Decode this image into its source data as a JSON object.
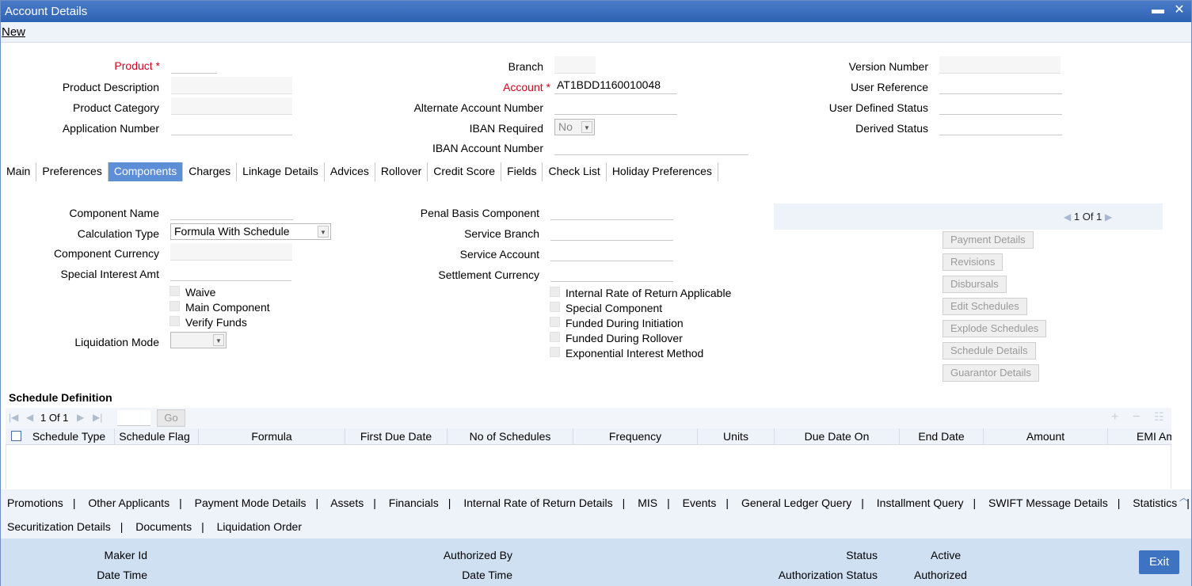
{
  "window": {
    "title": "Account Details",
    "minimize_glyph": "▬",
    "close_glyph": "✕"
  },
  "toolbar": {
    "new_label": "New"
  },
  "header": {
    "product_label": "Product",
    "product_value": "",
    "product_description_label": "Product Description",
    "product_description_value": "",
    "product_category_label": "Product Category",
    "product_category_value": "",
    "application_number_label": "Application Number",
    "application_number_value": "",
    "branch_label": "Branch",
    "branch_value": "",
    "account_label": "Account",
    "account_value": "AT1BDD1160010048",
    "alternate_account_label": "Alternate Account Number",
    "alternate_account_value": "",
    "iban_required_label": "IBAN Required",
    "iban_required_value": "No",
    "iban_account_label": "IBAN Account Number",
    "iban_account_value": "",
    "version_number_label": "Version Number",
    "version_number_value": "",
    "user_reference_label": "User Reference",
    "user_reference_value": "",
    "user_defined_status_label": "User Defined Status",
    "user_defined_status_value": "",
    "derived_status_label": "Derived Status",
    "derived_status_value": "",
    "required_mark": "*"
  },
  "tabs": [
    "Main",
    "Preferences",
    "Components",
    "Charges",
    "Linkage Details",
    "Advices",
    "Rollover",
    "Credit Score",
    "Fields",
    "Check List",
    "Holiday Preferences"
  ],
  "active_tab": "Components",
  "components": {
    "component_name_label": "Component Name",
    "component_name_value": "",
    "calculation_type_label": "Calculation Type",
    "calculation_type_value": "Formula With Schedule",
    "component_currency_label": "Component Currency",
    "component_currency_value": "",
    "special_interest_label": "Special Interest Amt",
    "special_interest_value": "",
    "waive_label": "Waive",
    "main_component_label": "Main Component",
    "verify_funds_label": "Verify Funds",
    "liquidation_mode_label": "Liquidation Mode",
    "liquidation_mode_value": "",
    "penal_basis_label": "Penal Basis Component",
    "penal_basis_value": "",
    "service_branch_label": "Service Branch",
    "service_branch_value": "",
    "service_account_label": "Service Account",
    "service_account_value": "",
    "settlement_currency_label": "Settlement Currency",
    "settlement_currency_value": "",
    "irr_applicable_label": "Internal Rate of Return Applicable",
    "special_component_label": "Special Component",
    "funded_initiation_label": "Funded During Initiation",
    "funded_rollover_label": "Funded During Rollover",
    "exponential_label": "Exponential Interest Method",
    "pager_text": "1 Of 1",
    "buttons": [
      "Payment Details",
      "Revisions",
      "Disbursals",
      "Edit Schedules",
      "Explode Schedules",
      "Schedule Details",
      "Guarantor Details"
    ]
  },
  "schedule": {
    "title": "Schedule Definition",
    "pager_text": "1 Of 1",
    "go_label": "Go",
    "columns": [
      "Schedule Type",
      "Schedule Flag",
      "Formula",
      "First Due Date",
      "No of Schedules",
      "Frequency",
      "Units",
      "Due Date On",
      "End Date",
      "Amount",
      "EMI Amount"
    ]
  },
  "links": {
    "row1": [
      "Promotions",
      "Other Applicants",
      "Payment Mode Details",
      "Assets",
      "Financials",
      "Internal Rate of Return Details",
      "MIS",
      "Events",
      "General Ledger Query",
      "Installment Query",
      "SWIFT Message Details",
      "Statistics"
    ],
    "row2": [
      "Securitization Details",
      "Documents",
      "Liquidation Order"
    ],
    "separator": "|"
  },
  "footer": {
    "maker_id_label": "Maker Id",
    "maker_id_value": "",
    "maker_datetime_label": "Date Time",
    "maker_datetime_value": "",
    "authorized_by_label": "Authorized By",
    "authorized_by_value": "",
    "checker_datetime_label": "Date Time",
    "checker_datetime_value": "",
    "status_label": "Status",
    "status_value": "Active",
    "auth_status_label": "Authorization Status",
    "auth_status_value": "Authorized",
    "exit_label": "Exit"
  }
}
